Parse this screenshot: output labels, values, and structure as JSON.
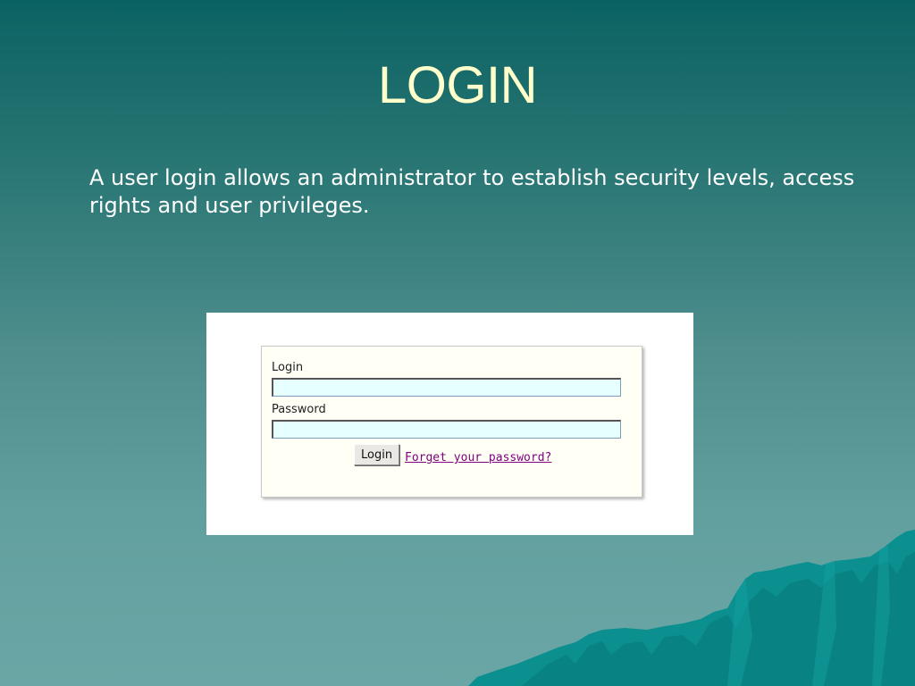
{
  "slide": {
    "title": "LOGIN",
    "body": "A user login allows an administrator to establish security levels, access rights and user privileges."
  },
  "login_form": {
    "login_label": "Login",
    "login_value": "",
    "password_label": "Password",
    "password_value": "",
    "button_label": "Login",
    "forgot_link": "Forget your password?"
  },
  "colors": {
    "title": "#ffffcc",
    "input_background": "#e6ffff",
    "link": "#800080",
    "mountain": "#0b8f8f"
  },
  "icons": {
    "decoration": "mountain-icon"
  }
}
